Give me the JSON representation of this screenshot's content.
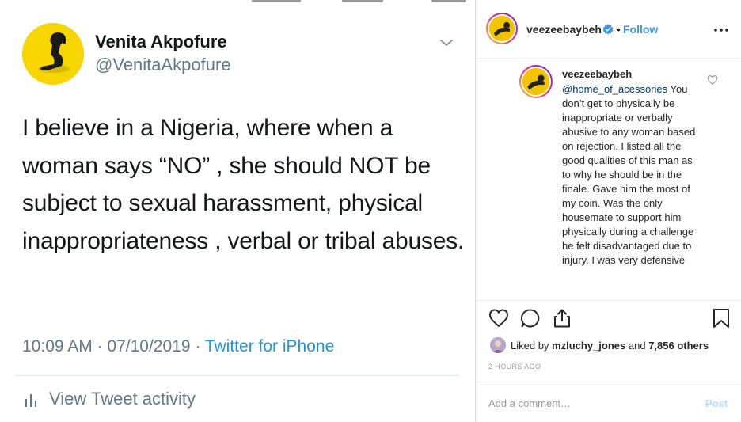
{
  "tweet": {
    "display_name": "Venita Akpofure",
    "handle": "@VenitaAkpofure",
    "text": "I believe in a Nigeria, where when a woman says “NO” , she should NOT be subject to sexual harassment, physical inappropriateness , verbal or tribal abuses.",
    "time": "10:09 AM",
    "date": "07/10/2019",
    "separator": "·",
    "source": "Twitter for iPhone",
    "activity_label": "View Tweet activity",
    "colors": {
      "link": "#1b95e0",
      "meta": "#657786",
      "avatar_bg": "#f7d600"
    }
  },
  "instagram": {
    "header": {
      "username": "veezeebaybeh",
      "dot": "•",
      "follow_label": "Follow",
      "more_icon": "more-horizontal-icon"
    },
    "caption": {
      "username": "veezeebaybeh",
      "mention": "@home_of_acessories",
      "text": " You don’t get to physically be inappropriate or verbally abusive to any woman based on rejection. I listed all the good qualities of this man as to why he should be in the finale. Gave him the most of my coin. Was the only housemate to support him physically during a challenge he felt disadvantaged due to injury. I was very defensive"
    },
    "actions": {
      "like_icon": "heart-icon",
      "comment_icon": "comment-icon",
      "share_icon": "share-icon",
      "save_icon": "bookmark-icon"
    },
    "likes": {
      "prefix": "Liked by",
      "user": "mzluchy_jones",
      "middle": "and",
      "others": "7,856 others"
    },
    "timestamp": "2 HOURS AGO",
    "comment": {
      "placeholder": "Add a comment…",
      "post_label": "Post"
    },
    "colors": {
      "follow": "#3897f0",
      "mention": "#003569",
      "post_disabled": "#b2dffc",
      "muted": "#999999"
    }
  }
}
